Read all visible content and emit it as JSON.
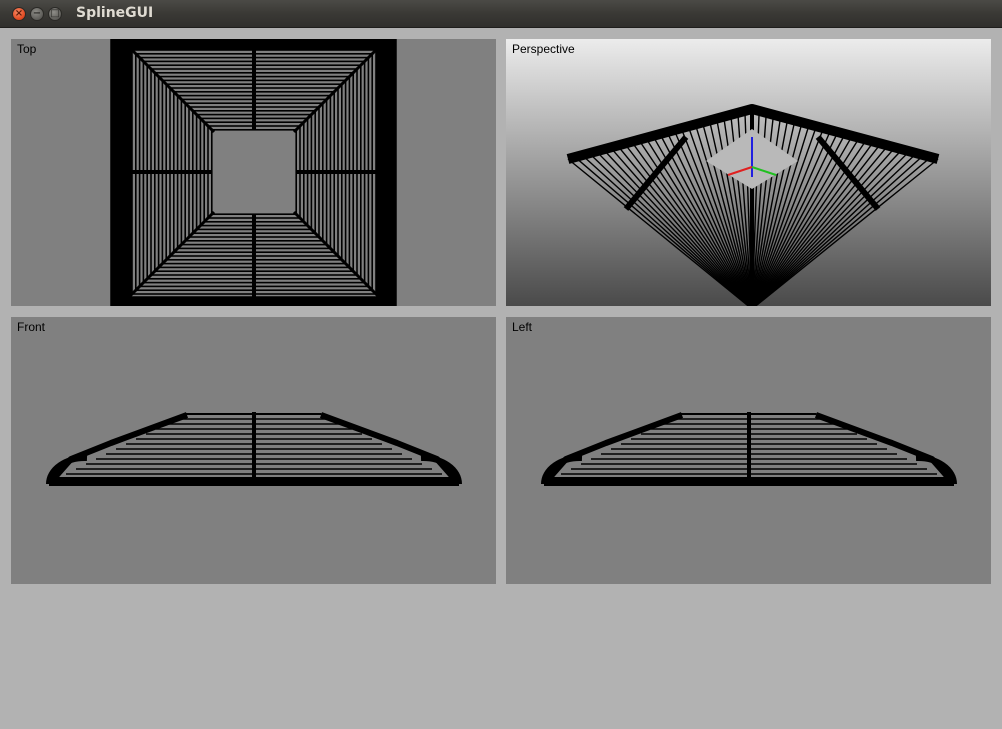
{
  "window": {
    "title": "SplineGUI",
    "close_glyph": "×",
    "minimize_glyph": "−",
    "maximize_glyph": "□"
  },
  "viewports": {
    "top": {
      "label": "Top"
    },
    "perspective": {
      "label": "Perspective"
    },
    "front": {
      "label": "Front"
    },
    "left": {
      "label": "Left"
    }
  },
  "colors": {
    "background": "#b2b2b2",
    "viewport": "#808080",
    "wireframe": "#000000",
    "axis_x": "#e02020",
    "axis_y": "#20c020",
    "axis_z": "#2020e0"
  }
}
